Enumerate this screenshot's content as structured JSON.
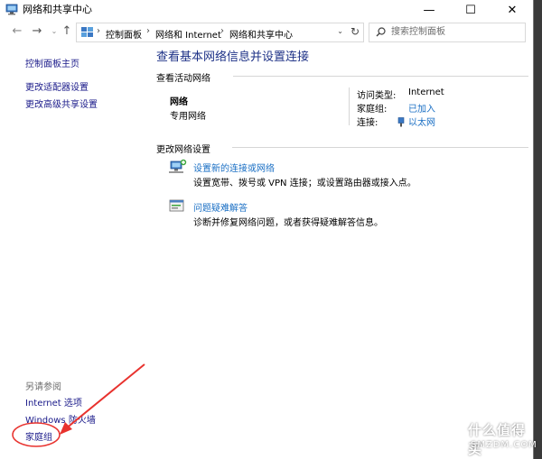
{
  "window": {
    "title": "网络和共享中心"
  },
  "caption_buttons": {
    "minimize": "—",
    "maximize": "☐",
    "close": "✕"
  },
  "address": {
    "crumbs": [
      "控制面板",
      "网络和 Internet",
      "网络和共享中心"
    ],
    "search_placeholder": "搜索控制面板"
  },
  "left_pane": {
    "links": [
      "控制面板主页",
      "更改适配器设置",
      "更改高级共享设置"
    ],
    "see_also_label": "另请参阅",
    "see_also_links": [
      "Internet 选项",
      "Windows 防火墙",
      "家庭组"
    ]
  },
  "main": {
    "heading": "查看基本网络信息并设置连接",
    "active_networks_label": "查看活动网络",
    "network": {
      "name": "网络",
      "type": "专用网络"
    },
    "details": [
      {
        "key": "访问类型:",
        "value": "Internet"
      },
      {
        "key": "家庭组:",
        "value": "已加入"
      },
      {
        "key": "连接:",
        "value": "以太网"
      }
    ],
    "change_settings_label": "更改网络设置",
    "tasks": [
      {
        "title": "设置新的连接或网络",
        "desc": "设置宽带、拨号或 VPN 连接；或设置路由器或接入点。"
      },
      {
        "title": "问题疑难解答",
        "desc": "诊断并修复网络问题，或者获得疑难解答信息。"
      }
    ]
  },
  "watermark": {
    "text": "什么值得买",
    "sub": "SMZDM.COM"
  },
  "colors": {
    "link": "#1a6fc4",
    "heading": "#1e3287",
    "annotation": "#e8322e"
  }
}
